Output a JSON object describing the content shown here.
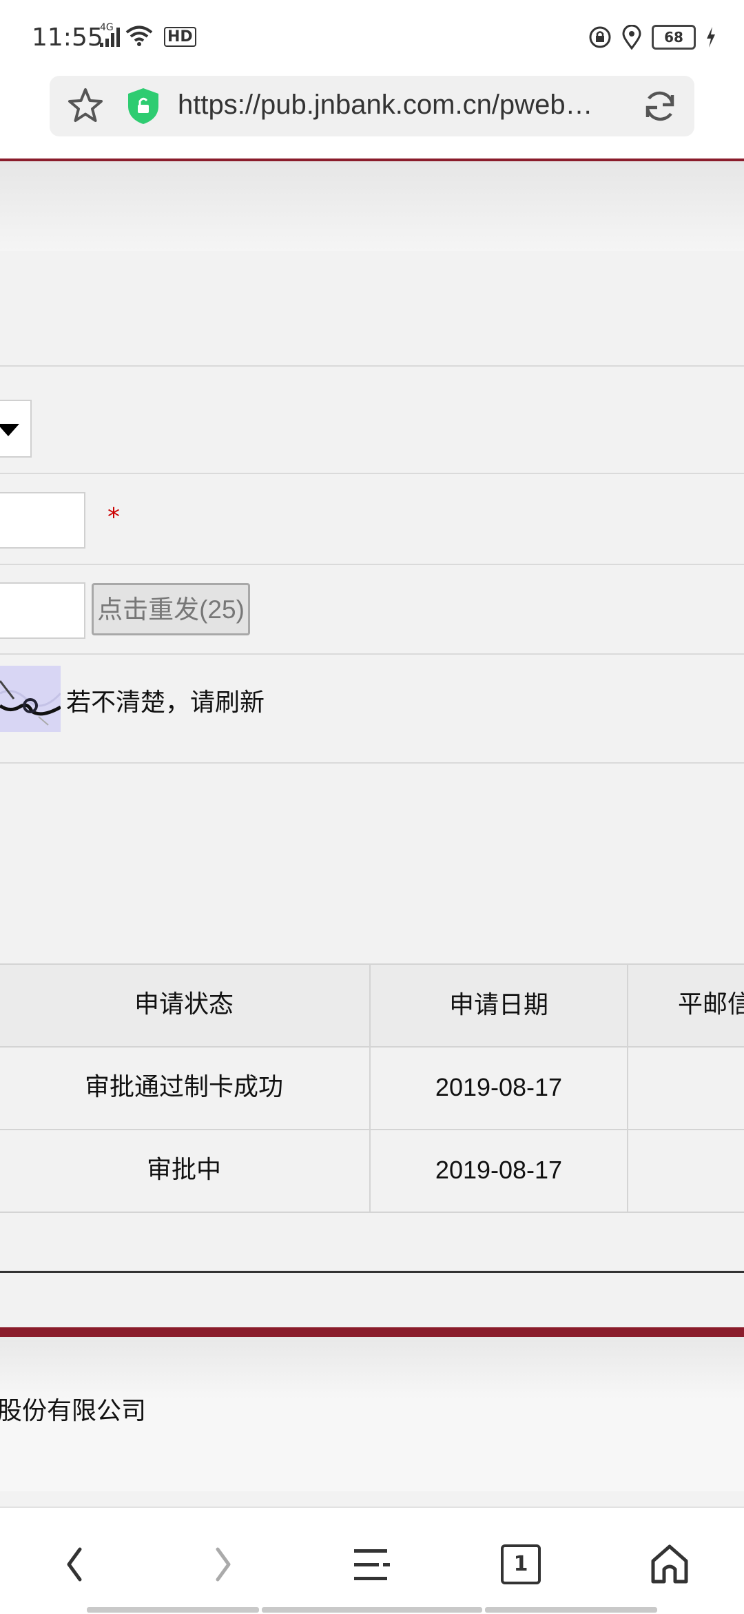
{
  "status_bar": {
    "time": "11:55",
    "network": "4G",
    "hd": "HD",
    "battery": "68",
    "icons": [
      "signal-icon",
      "wifi-icon",
      "hd-icon",
      "lock-rotation-icon",
      "location-icon",
      "battery-icon",
      "charging-icon"
    ]
  },
  "browser": {
    "url": "https://pub.jnbank.com.cn/pweb…",
    "icons": [
      "star-icon",
      "secure-shield-icon",
      "reload-icon"
    ],
    "accent": "#8a1c2b"
  },
  "form": {
    "required_mark": "*",
    "resend_button": "点击重发(25)",
    "captcha_hint": "若不清楚，请刷新"
  },
  "table": {
    "headers": [
      "申请状态",
      "申请日期",
      "平邮信"
    ],
    "rows": [
      [
        "审批通过制卡成功",
        "2019-08-17",
        ""
      ],
      [
        "审批中",
        "2019-08-17",
        ""
      ]
    ]
  },
  "footer": {
    "company": "股份有限公司"
  },
  "nav": {
    "back": "back-icon",
    "forward": "forward-icon",
    "menu": "menu-icon",
    "tabs_count": "1",
    "home": "home-icon"
  }
}
